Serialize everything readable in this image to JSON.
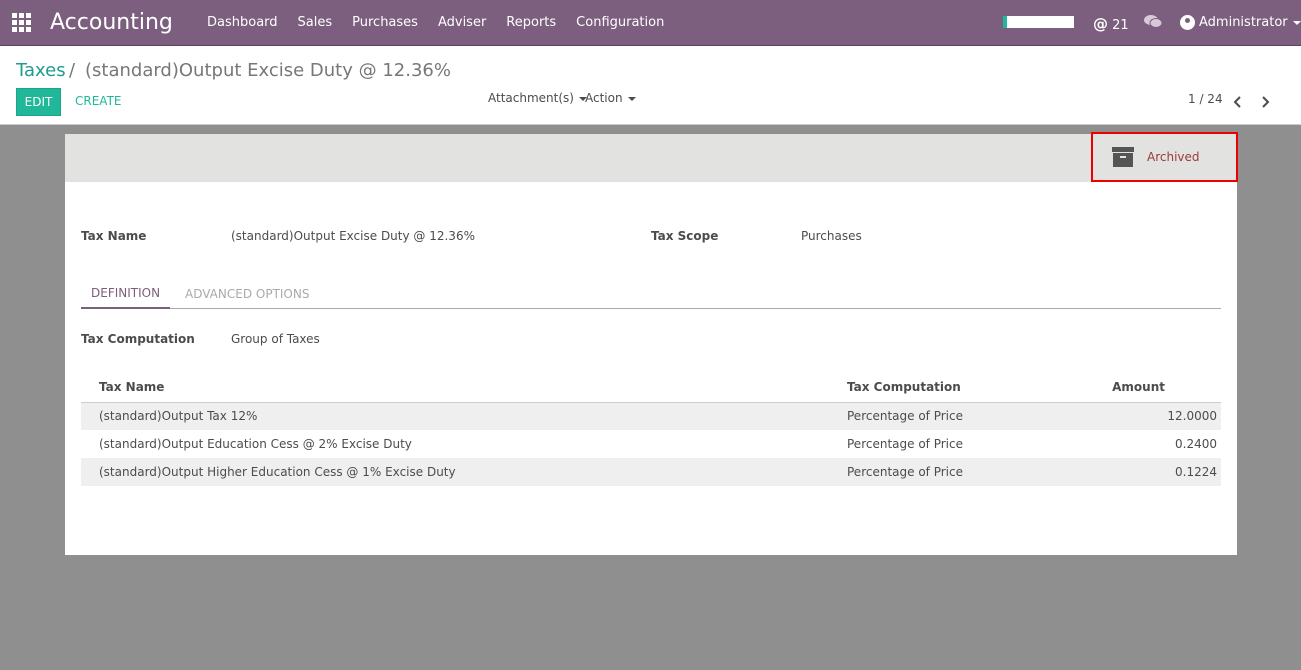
{
  "app": {
    "title": "Accounting"
  },
  "nav": {
    "menu": [
      "Dashboard",
      "Sales",
      "Purchases",
      "Adviser",
      "Reports",
      "Configuration"
    ],
    "mentions_count": "21",
    "user": "Administrator",
    "progress_fraction": 0.05
  },
  "breadcrumb": {
    "root": "Taxes",
    "sep": "/",
    "current": "(standard)Output Excise Duty @ 12.36%"
  },
  "buttons": {
    "edit": "EDIT",
    "create": "CREATE",
    "attachments": "Attachment(s)",
    "action": "Action"
  },
  "pager": {
    "text": "1 / 24"
  },
  "status": {
    "archived": "Archived"
  },
  "form": {
    "tax_name_label": "Tax Name",
    "tax_name_value": "(standard)Output Excise Duty @ 12.36%",
    "tax_scope_label": "Tax Scope",
    "tax_scope_value": "Purchases",
    "tabs": [
      "DEFINITION",
      "ADVANCED OPTIONS"
    ],
    "computation_label": "Tax Computation",
    "computation_value": "Group of Taxes"
  },
  "table": {
    "headers": [
      "Tax Name",
      "Tax Computation",
      "Amount"
    ],
    "rows": [
      [
        "(standard)Output Tax 12%",
        "Percentage of Price",
        "12.0000"
      ],
      [
        "(standard)Output Education Cess @ 2% Excise Duty",
        "Percentage of Price",
        "0.2400"
      ],
      [
        "(standard)Output Higher Education Cess @ 1% Excise Duty",
        "Percentage of Price",
        "0.1224"
      ]
    ]
  },
  "colors": {
    "navbar": "#7c5e7e",
    "primary": "#21b799",
    "archived_text": "#9b3b3b",
    "highlight_border": "#ee0000"
  }
}
